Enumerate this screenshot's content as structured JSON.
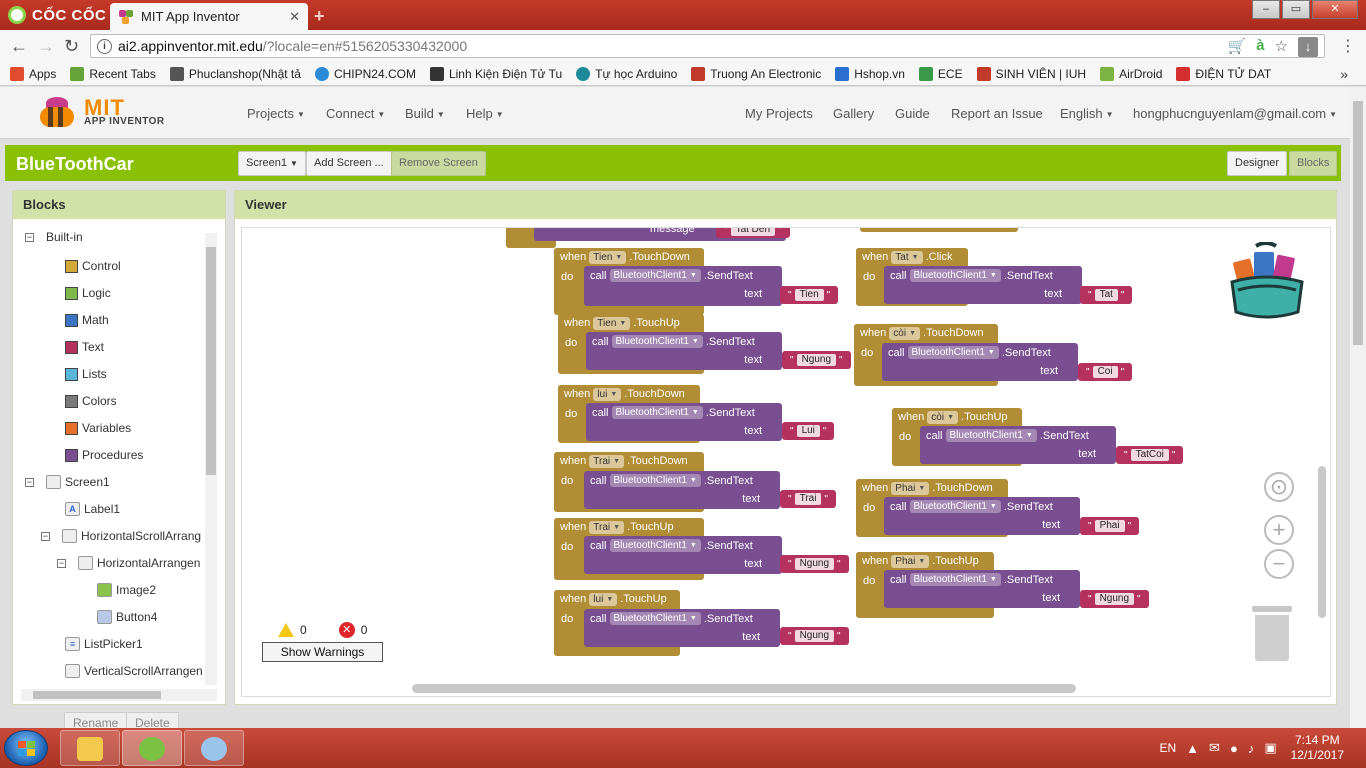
{
  "browser": {
    "brand": "CỐC CỐC",
    "tab_title": "MIT App Inventor",
    "tab_close": "✕",
    "new_tab": "+",
    "win_min": "–",
    "win_max": "▭",
    "win_close": "✕",
    "url_host": "ai2.appinventor.mit.edu",
    "url_path": "/?locale=en#5156205330432000",
    "bookmarks": [
      {
        "label": "Apps",
        "color": "#e14b2e"
      },
      {
        "label": "Recent Tabs",
        "color": "#66a338"
      },
      {
        "label": "Phuclanshop(Nhật tả",
        "color": "#555555"
      },
      {
        "label": "CHIPN24.COM",
        "color": "#2b8bd6"
      },
      {
        "label": "Linh Kiện Điện Tử Tu",
        "color": "#333333"
      },
      {
        "label": "Tự học Arduino",
        "color": "#1e8a99"
      },
      {
        "label": "Truong An Electronic",
        "color": "#c0392b"
      },
      {
        "label": "Hshop.vn",
        "color": "#2a6fcf"
      },
      {
        "label": "ECE",
        "color": "#3a9a4a"
      },
      {
        "label": "SINH VIÊN | IUH",
        "color": "#c0392b"
      },
      {
        "label": "AirDroid",
        "color": "#7cb342"
      },
      {
        "label": "ĐIỆN TỬ DAT",
        "color": "#d32f2f"
      }
    ],
    "bookmarks_more": "»"
  },
  "ai_header": {
    "logo_mit": "MIT",
    "logo_sub": "APP INVENTOR",
    "menus": [
      "Projects",
      "Connect",
      "Build",
      "Help"
    ],
    "right_links": [
      "My Projects",
      "Gallery",
      "Guide",
      "Report an Issue"
    ],
    "language": "English",
    "account": "hongphucnguyenlam@gmail.com"
  },
  "project": {
    "name": "BlueToothCar",
    "screen_select": "Screen1",
    "add_screen": "Add Screen ...",
    "remove_screen": "Remove Screen",
    "designer": "Designer",
    "blocks": "Blocks"
  },
  "blocks_panel": {
    "title": "Blocks",
    "builtin": "Built-in",
    "categories": [
      {
        "label": "Control",
        "color": "#d4a838"
      },
      {
        "label": "Logic",
        "color": "#7fb94b"
      },
      {
        "label": "Math",
        "color": "#3b75c4"
      },
      {
        "label": "Text",
        "color": "#b5325f"
      },
      {
        "label": "Lists",
        "color": "#58b6d8"
      },
      {
        "label": "Colors",
        "color": "#7a7a7a"
      },
      {
        "label": "Variables",
        "color": "#e5702a"
      },
      {
        "label": "Procedures",
        "color": "#7a4f91"
      }
    ],
    "components": [
      "Screen1",
      "Label1",
      "HorizontalScrollArrang",
      "HorizontalArrangen",
      "Image2",
      "Button4",
      "ListPicker1",
      "VerticalScrollArrangen"
    ],
    "rename": "Rename",
    "delete": "Delete"
  },
  "viewer": {
    "title": "Viewer",
    "kw_when": "when",
    "kw_do": "do",
    "kw_call": "call",
    "kw_text": "text",
    "kw_message": "message",
    "component_bt": "BluetoothClient1",
    "method": ".SendText",
    "quote": "\"",
    "partial_text": "Tat Den",
    "events": [
      {
        "btn": "Tien",
        "event": ".TouchDown",
        "text": "Tien"
      },
      {
        "btn": "Tien",
        "event": ".TouchUp",
        "text": "Ngung"
      },
      {
        "btn": "lui",
        "event": ".TouchDown",
        "text": "Lui"
      },
      {
        "btn": "Trai",
        "event": ".TouchDown",
        "text": "Trai"
      },
      {
        "btn": "Trai",
        "event": ".TouchUp",
        "text": "Ngung"
      },
      {
        "btn": "lui",
        "event": ".TouchUp",
        "text": "Ngung"
      },
      {
        "btn": "Tat",
        "event": ".Click",
        "text": "Tat"
      },
      {
        "btn": "còi",
        "event": ".TouchDown",
        "text": "Coi"
      },
      {
        "btn": "còi",
        "event": ".TouchUp",
        "text": "TatCoi"
      },
      {
        "btn": "Phai",
        "event": ".TouchDown",
        "text": "Phai"
      },
      {
        "btn": "Phai",
        "event": ".TouchUp",
        "text": "Ngung"
      }
    ],
    "warnings_count": "0",
    "errors_count": "0",
    "show_warnings": "Show Warnings"
  },
  "taskbar": {
    "lang": "EN",
    "time": "7:14 PM",
    "date": "12/1/2017"
  }
}
